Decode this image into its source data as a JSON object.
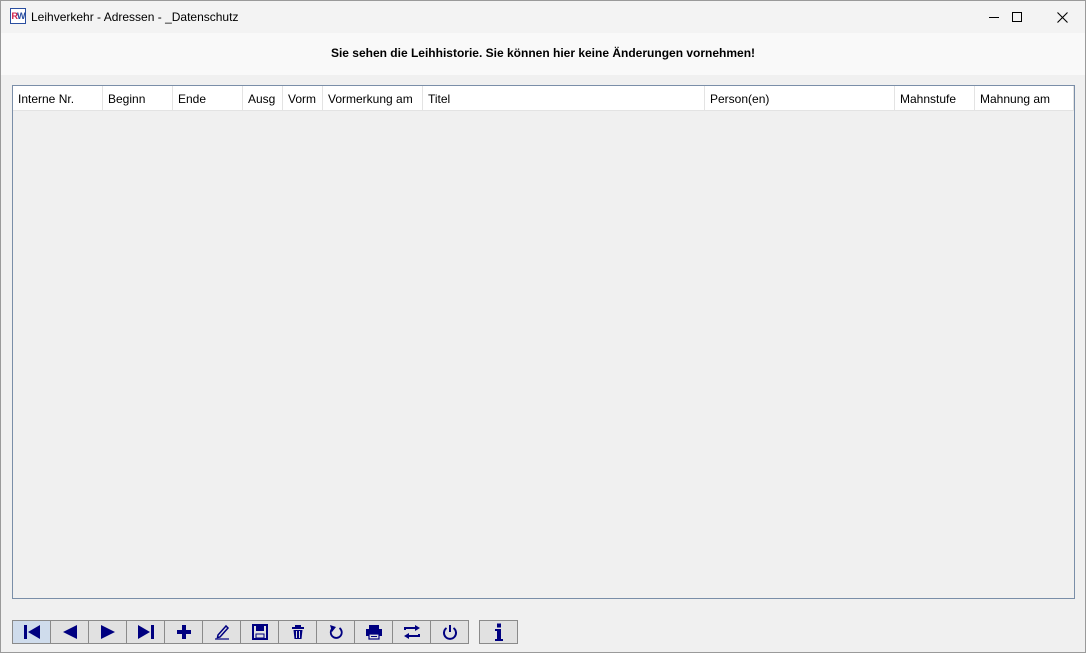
{
  "window": {
    "title": "Leihverkehr - Adressen - _Datenschutz",
    "app_icon": "RW",
    "controls": [
      "minimize-icon",
      "maximize-icon",
      "close-icon"
    ]
  },
  "banner": {
    "message": "Sie sehen die Leihhistorie. Sie können hier keine Änderungen vornehmen!"
  },
  "grid": {
    "columns": [
      "Interne Nr.",
      "Beginn",
      "Ende",
      "Ausg",
      "Vorm",
      "Vormerkung am",
      "Titel",
      "Person(en)",
      "Mahnstufe",
      "Mahnung am"
    ],
    "rows": []
  },
  "toolbar": {
    "buttons": [
      "first-record-icon",
      "previous-record-icon",
      "next-record-icon",
      "last-record-icon",
      "add-icon",
      "edit-icon",
      "save-icon",
      "delete-icon",
      "undo-icon",
      "print-icon",
      "switch-icon",
      "power-icon",
      "info-icon"
    ],
    "icon_color": "#000080"
  }
}
